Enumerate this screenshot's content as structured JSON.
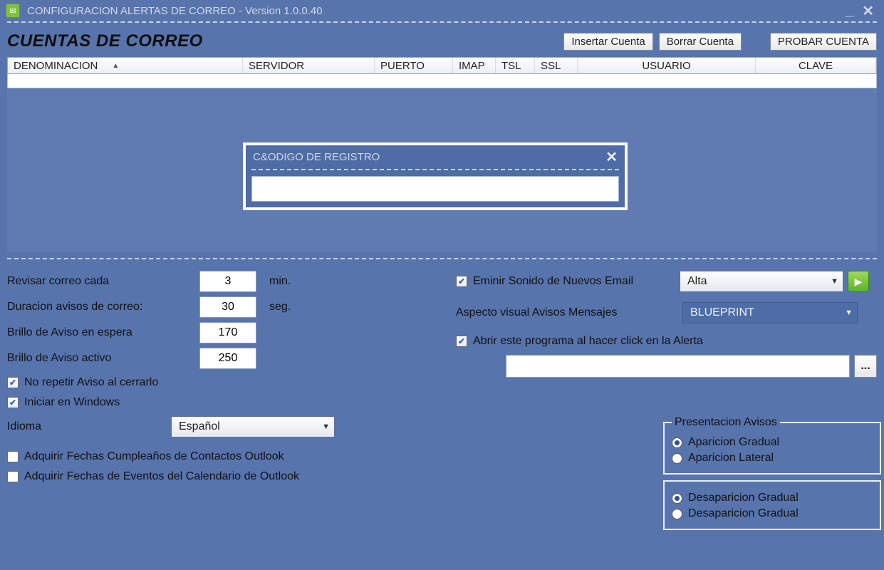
{
  "title": "CONFIGURACION ALERTAS DE CORREO  -  Version 1.0.0.40",
  "section_title": "CUENTAS DE CORREO",
  "buttons": {
    "insert": "Insertar Cuenta",
    "delete": "Borrar Cuenta",
    "test": "PROBAR CUENTA"
  },
  "columns": {
    "denom": "DENOMINACION",
    "serv": "SERVIDOR",
    "port": "PUERTO",
    "imap": "IMAP",
    "tsl": "TSL",
    "ssl": "SSL",
    "user": "USUARIO",
    "clave": "CLAVE"
  },
  "registration": {
    "title": "C&ODIGO DE REGISTRO"
  },
  "settings_left": {
    "check_every_label": "Revisar correo cada",
    "check_every_value": "3",
    "check_every_unit": "min.",
    "duration_label": "Duracion avisos de correo:",
    "duration_value": "30",
    "duration_unit": "seg.",
    "bright_wait_label": "Brillo de Aviso en espera",
    "bright_wait_value": "170",
    "bright_active_label": "Brillo de Aviso activo",
    "bright_active_value": "250",
    "no_repeat_label": "No repetir Aviso al cerrarlo",
    "start_windows_label": "Iniciar en Windows",
    "language_label": "Idioma",
    "language_value": "Español",
    "birthdays_label": "Adquirir Fechas Cumpleaños de Contactos Outlook",
    "events_label": "Adquirir Fechas de Eventos del Calendario de Outlook"
  },
  "settings_right": {
    "emit_sound_label": "Eminir Sonido de Nuevos Email",
    "sound_value": "Alta",
    "visual_aspect_label": "Aspecto visual Avisos Mensajes",
    "visual_aspect_value": "BLUEPRINT",
    "open_program_label": "Abrir este programa al hacer click en la Alerta",
    "dots": "..."
  },
  "presentation": {
    "legend": "Presentacion Avisos",
    "opt1": "Aparicion Gradual",
    "opt2": "Aparicion Lateral",
    "opt3": "Desaparicion Gradual",
    "opt4": "Desaparicion Gradual"
  }
}
